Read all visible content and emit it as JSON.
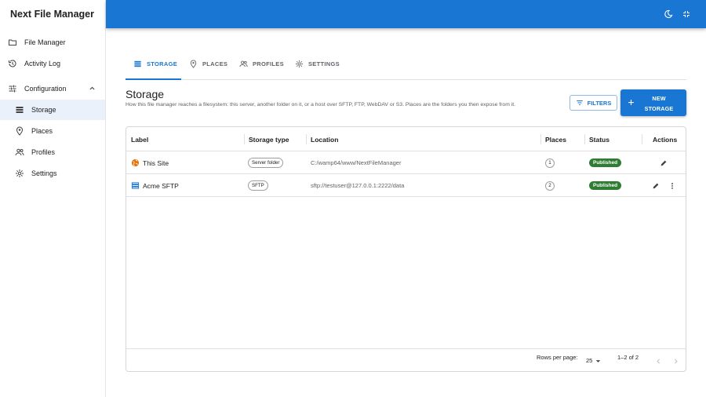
{
  "sidebar": {
    "app_title": "Next File Manager",
    "items": [
      {
        "label": "File Manager",
        "icon": "folder-icon"
      },
      {
        "label": "Activity Log",
        "icon": "history-icon"
      },
      {
        "label": "Configuration",
        "icon": "tune-icon"
      },
      {
        "label": "Storage",
        "icon": "storage-icon"
      },
      {
        "label": "Places",
        "icon": "place-icon"
      },
      {
        "label": "Profiles",
        "icon": "people-icon"
      },
      {
        "label": "Settings",
        "icon": "gear-icon"
      }
    ],
    "active_item": "Storage"
  },
  "header": {
    "bg_color": "#1976d2",
    "icons": [
      "dark-mode-icon",
      "fullscreen-exit-icon"
    ]
  },
  "tabs": [
    {
      "label": "STORAGE",
      "icon": "storage-icon",
      "active": true
    },
    {
      "label": "PLACES",
      "icon": "place-icon",
      "active": false
    },
    {
      "label": "PROFILES",
      "icon": "people-icon",
      "active": false
    },
    {
      "label": "SETTINGS",
      "icon": "gear-icon",
      "active": false
    }
  ],
  "page": {
    "title": "Storage",
    "description": "How this file manager reaches a filesystem: this server, another folder on it, or a host over SFTP, FTP, WebDAV or S3. Places are the folders you then expose from it.",
    "filters_label": "FILTERS",
    "new_label_1": "NEW",
    "new_label_2": "STORAGE"
  },
  "table": {
    "columns": [
      "Label",
      "Storage type",
      "Location",
      "Places",
      "Status",
      "Actions"
    ],
    "rows": [
      {
        "label": "This Site",
        "icon": "globe-icon",
        "type": "Server folder",
        "location": "C:/wamp64/www/NextFileManager",
        "places": "1",
        "status": "Published"
      },
      {
        "label": "Acme SFTP",
        "icon": "storage-icon",
        "type": "SFTP",
        "location": "sftp://testuser@127.0.0.1:2222/data",
        "places": "2",
        "status": "Published"
      }
    ],
    "footer": {
      "rows_per_page_label": "Rows per page:",
      "rows_per_page": "25",
      "range": "1–2 of 2"
    }
  },
  "colors": {
    "accent": "#1976d2",
    "published": "#2e7d32",
    "globe": "#e8710a"
  }
}
